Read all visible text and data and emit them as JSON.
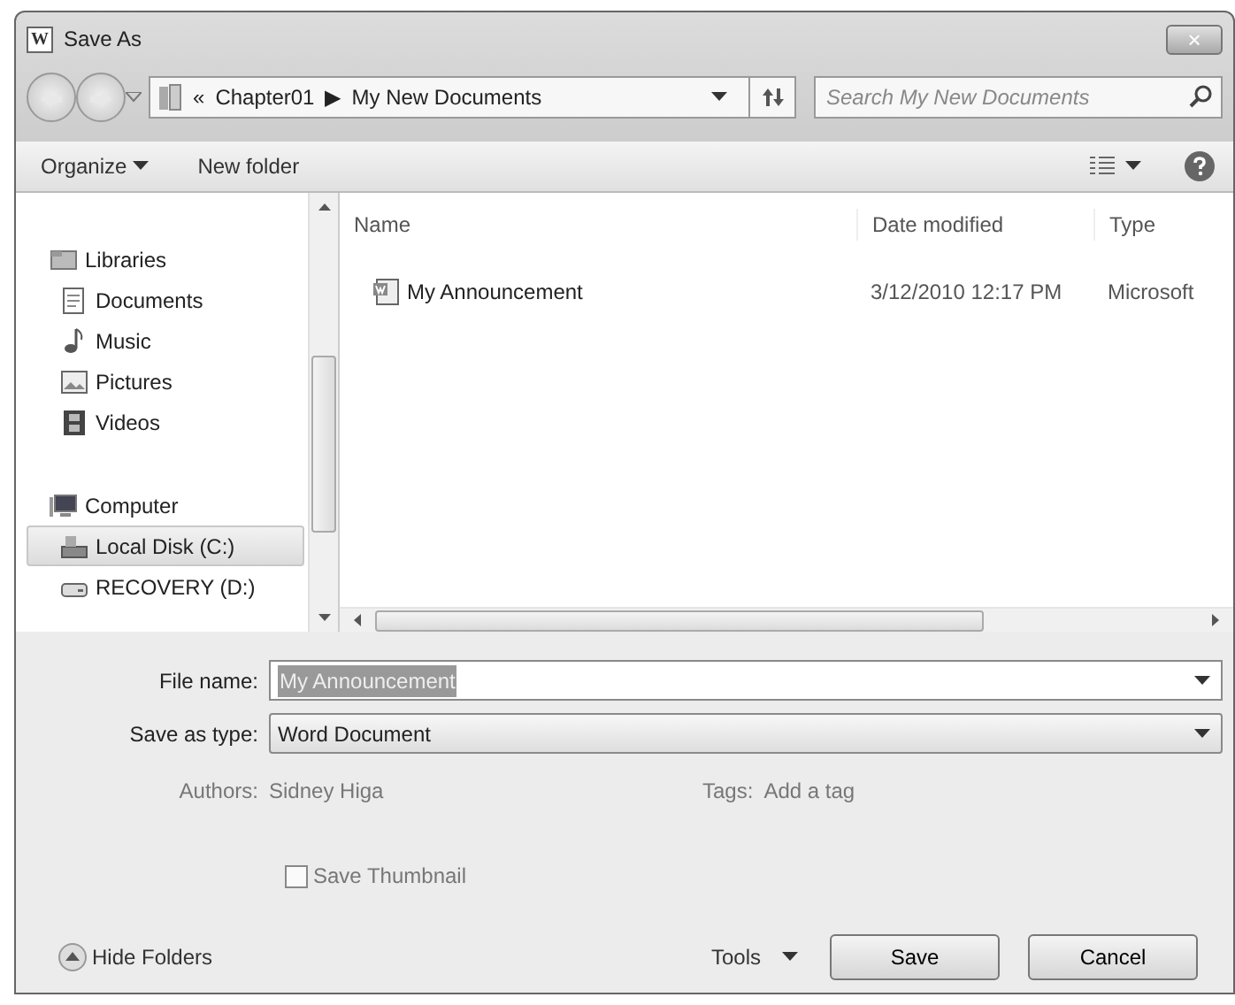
{
  "window": {
    "title": "Save As",
    "app_icon": "W",
    "close": "×"
  },
  "address": {
    "prefix": "«",
    "path": [
      "Chapter01",
      "My New Documents"
    ],
    "separator": "▶"
  },
  "search": {
    "placeholder": "Search My New Documents"
  },
  "toolbar": {
    "organize": "Organize",
    "new_folder": "New folder"
  },
  "nav_pane": [
    {
      "label": "Libraries",
      "kind": "libraries",
      "selected": false,
      "children": [
        {
          "label": "Documents",
          "kind": "documents",
          "selected": false
        },
        {
          "label": "Music",
          "kind": "music",
          "selected": false
        },
        {
          "label": "Pictures",
          "kind": "pictures",
          "selected": false
        },
        {
          "label": "Videos",
          "kind": "videos",
          "selected": false
        }
      ]
    },
    {
      "label": "Computer",
      "kind": "computer",
      "selected": false,
      "children": [
        {
          "label": "Local Disk (C:)",
          "kind": "disk",
          "selected": true
        },
        {
          "label": "RECOVERY (D:)",
          "kind": "drive",
          "selected": false
        }
      ]
    }
  ],
  "file_list": {
    "columns": [
      "Name",
      "Date modified",
      "Type"
    ],
    "rows": [
      {
        "name": "My Announcement",
        "date_modified": "3/12/2010 12:17 PM",
        "type": "Microsoft",
        "selected": false
      }
    ]
  },
  "form": {
    "file_name_label": "File name:",
    "file_name": "My Announcement",
    "save_as_type_label": "Save as type:",
    "save_as_type": "Word Document",
    "authors_label": "Authors:",
    "authors": "Sidney Higa",
    "tags_label": "Tags:",
    "tags": "Add a tag",
    "save_thumbnail": {
      "label": "Save Thumbnail",
      "checked": false
    }
  },
  "footer": {
    "hide_folders": "Hide Folders",
    "tools": "Tools",
    "save": "Save",
    "cancel": "Cancel"
  }
}
